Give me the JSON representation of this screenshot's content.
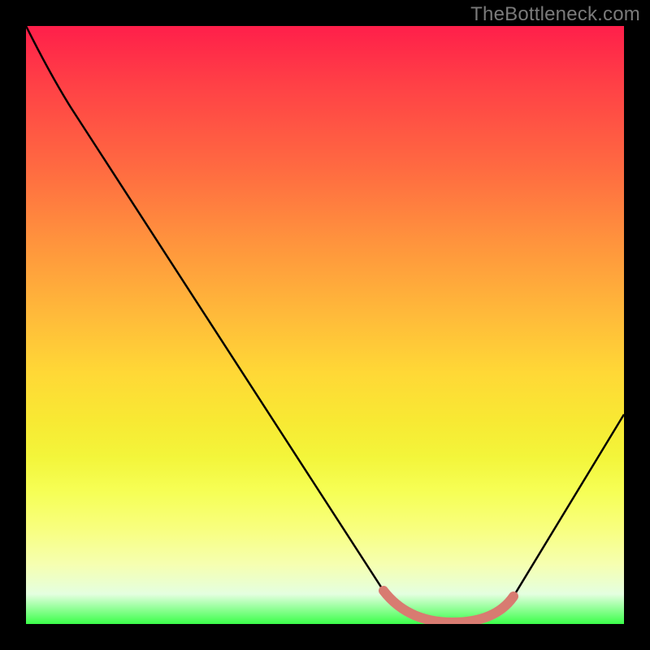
{
  "watermark": "TheBottleneck.com",
  "gradient_stops": [
    {
      "pos": 0,
      "color": "#ff1f4a"
    },
    {
      "pos": 10,
      "color": "#ff4146"
    },
    {
      "pos": 24,
      "color": "#ff6b41"
    },
    {
      "pos": 36,
      "color": "#ff933d"
    },
    {
      "pos": 48,
      "color": "#ffb93a"
    },
    {
      "pos": 58,
      "color": "#ffd836"
    },
    {
      "pos": 66,
      "color": "#f8e933"
    },
    {
      "pos": 72,
      "color": "#f3f53a"
    },
    {
      "pos": 78,
      "color": "#f6ff56"
    },
    {
      "pos": 84,
      "color": "#f8ff7e"
    },
    {
      "pos": 90,
      "color": "#f6ffb0"
    },
    {
      "pos": 95,
      "color": "#e4ffe0"
    },
    {
      "pos": 100,
      "color": "#3bff4a"
    }
  ],
  "chart_data": {
    "type": "line",
    "title": "",
    "xlabel": "",
    "ylabel": "",
    "xlim": [
      0,
      100
    ],
    "ylim": [
      0,
      100
    ],
    "series": [
      {
        "name": "bottleneck-curve",
        "color": "#000000",
        "x": [
          0,
          4,
          7,
          10,
          20,
          30,
          40,
          50,
          55,
          60,
          63,
          68,
          72,
          76,
          80,
          82,
          90,
          100
        ],
        "y": [
          100,
          94,
          89,
          86,
          70,
          54,
          38,
          22,
          13,
          6,
          2,
          0,
          0,
          1,
          4,
          7,
          20,
          35
        ]
      },
      {
        "name": "optimal-range-highlight",
        "color": "#d87b71",
        "x": [
          60,
          63,
          68,
          72,
          76,
          80,
          82
        ],
        "y": [
          6,
          2,
          0,
          0,
          1,
          4,
          7
        ]
      }
    ],
    "annotations": []
  }
}
